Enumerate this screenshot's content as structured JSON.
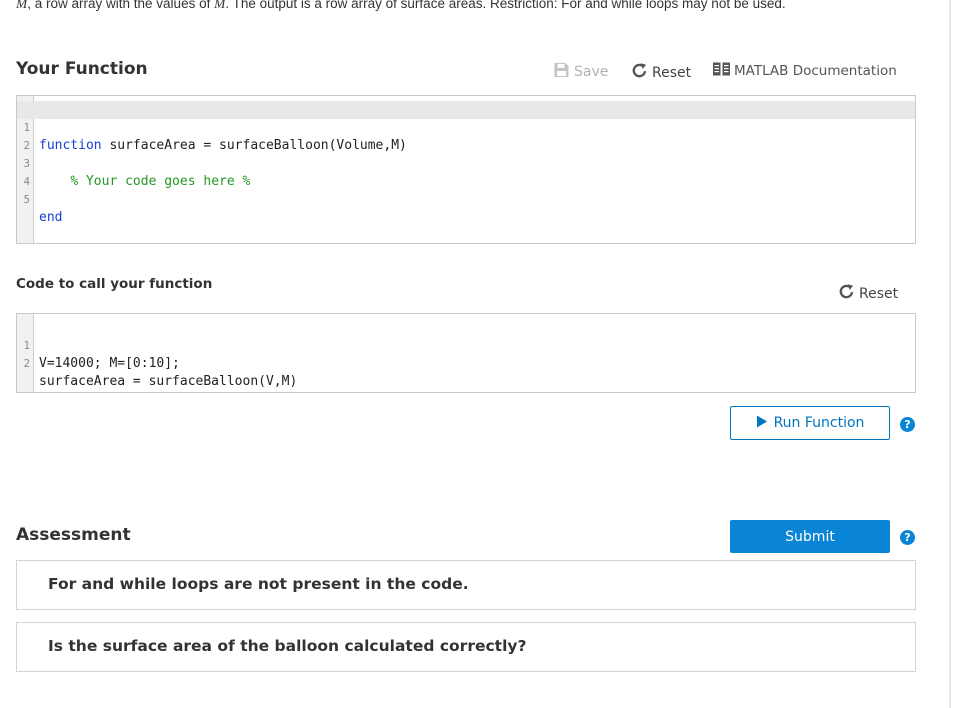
{
  "problem": {
    "tail_var1": "M",
    "tail_text1": ", a row array with the values of ",
    "tail_var2": "M",
    "tail_text2": ".  The output is a row array of surface areas.  Restriction: For and while loops may not be used."
  },
  "your_function": {
    "title": "Your Function",
    "save_label": "Save",
    "reset_label": "Reset",
    "doc_label": "MATLAB Documentation",
    "lines": [
      {
        "num": "1",
        "keyword": "function",
        "text": " surfaceArea = surfaceBalloon(Volume,M)",
        "comment": ""
      },
      {
        "num": "2",
        "keyword": "",
        "text": "",
        "comment": ""
      },
      {
        "num": "3",
        "keyword": "",
        "text": "    ",
        "comment": "% Your code goes here %"
      },
      {
        "num": "4",
        "keyword": "",
        "text": "",
        "comment": ""
      },
      {
        "num": "5",
        "keyword": "end",
        "text": "",
        "comment": ""
      }
    ]
  },
  "code_to_call": {
    "title": "Code to call your function",
    "reset_label": "Reset",
    "lines": [
      {
        "num": "1",
        "text": "V=14000; M=[0:10];"
      },
      {
        "num": "2",
        "text": "surfaceArea = surfaceBalloon(V,M)"
      }
    ],
    "run_label": "Run Function"
  },
  "assessment": {
    "title": "Assessment",
    "submit_label": "Submit",
    "tests": [
      "For and while loops are not present in the code.",
      "Is the surface area of the balloon calculated correctly?"
    ]
  },
  "help_glyph": "?",
  "colors": {
    "accent": "#0a85d5",
    "keyword": "#1a3fd6",
    "comment": "#229922"
  },
  "icons": {
    "save": "save-icon",
    "reset": "reset-icon",
    "doc": "book-icon",
    "run": "play-icon",
    "help": "help-icon"
  }
}
